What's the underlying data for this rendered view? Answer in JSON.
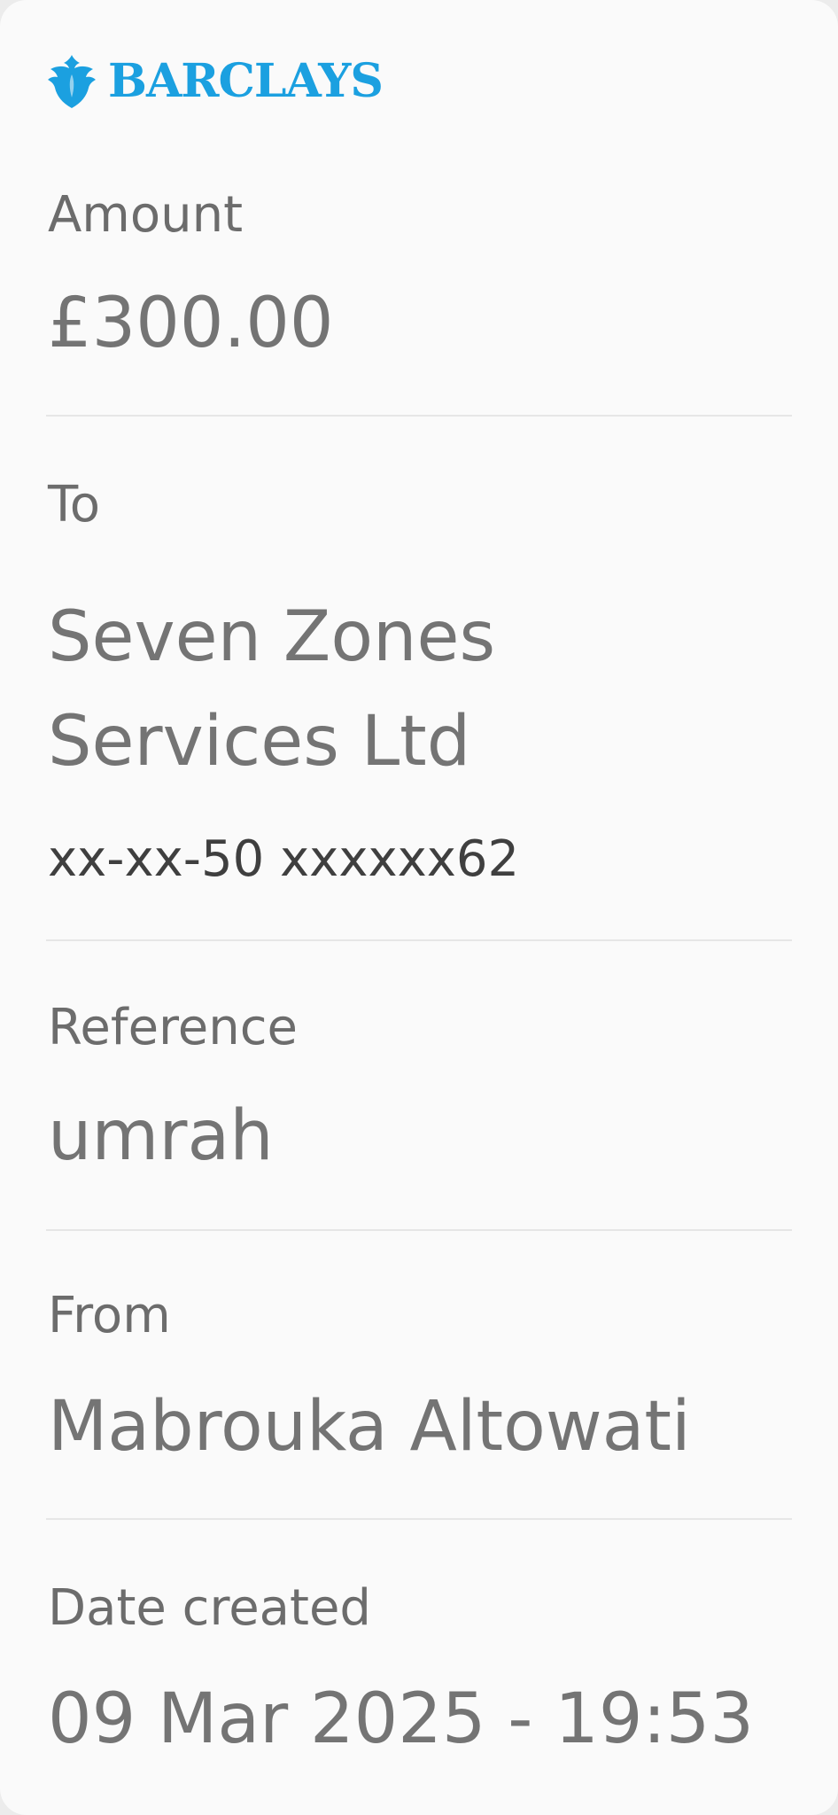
{
  "brand": {
    "name": "BARCLAYS",
    "color": "#1ba0e0",
    "icon": "eagle-icon"
  },
  "amount": {
    "label": "Amount",
    "value": "£300.00"
  },
  "to": {
    "label": "To",
    "payee": "Seven Zones Services Ltd",
    "account": "xx-xx-50 xxxxxx62"
  },
  "reference": {
    "label": "Reference",
    "value": "umrah"
  },
  "from": {
    "label": "From",
    "value": "Mabrouka Altowati"
  },
  "date_created": {
    "label": "Date created",
    "value": "09 Mar 2025 - 19:53"
  }
}
